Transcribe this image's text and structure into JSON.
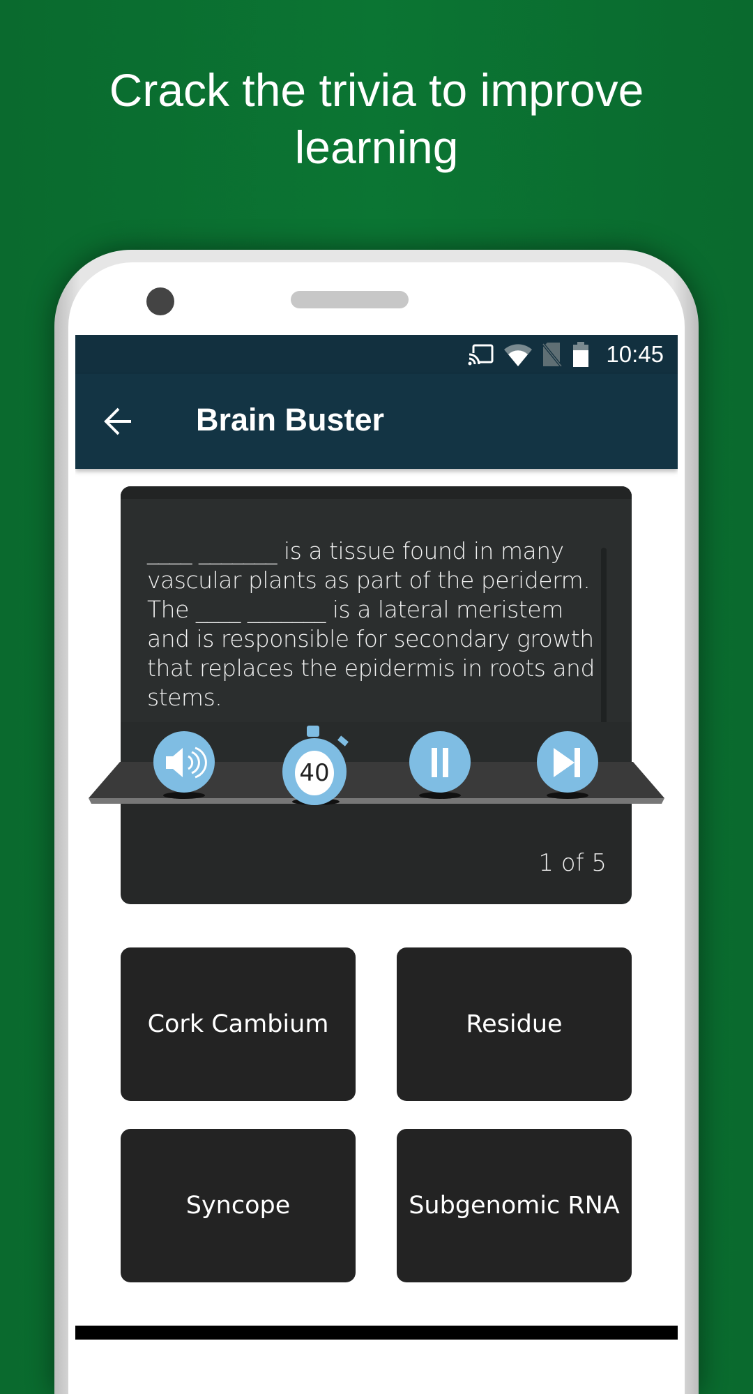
{
  "promo": {
    "headline_line1": "Crack the trivia to improve",
    "headline_line2": "learning",
    "background_color": "#0b7533"
  },
  "status_bar": {
    "icons": [
      "cast-icon",
      "wifi-icon",
      "no-sim-icon",
      "battery-icon"
    ],
    "time": "10:45"
  },
  "toolbar": {
    "back_icon": "arrow-left-icon",
    "title": "Brain Buster",
    "color": "#133444"
  },
  "quiz": {
    "question": "____ _______ is a tissue found in many vascular plants as part of the periderm. The ____ _______ is a lateral meristem and is responsible for secondary growth that replaces the epidermis in roots and stems.",
    "controls": {
      "sound_icon": "speaker-icon",
      "timer_icon": "stopwatch-icon",
      "timer_seconds": "40",
      "pause_icon": "pause-icon",
      "next_icon": "skip-next-icon",
      "accent": "#7fbde3"
    },
    "counter": "1 of 5",
    "answers": [
      {
        "label": "Cork Cambium"
      },
      {
        "label": "Residue"
      },
      {
        "label": "Syncope"
      },
      {
        "label": "Subgenomic RNA"
      }
    ]
  }
}
